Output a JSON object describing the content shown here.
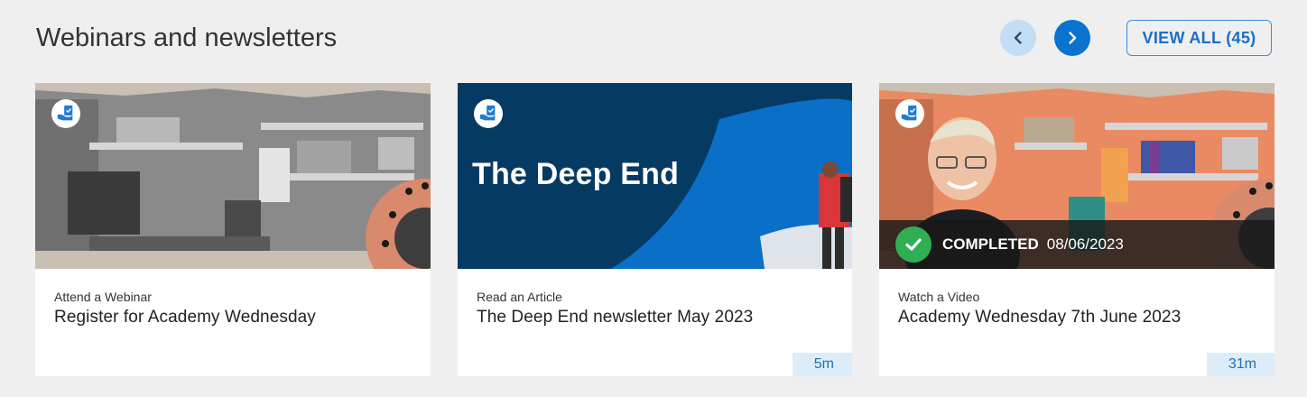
{
  "section": {
    "title": "Webinars and newsletters",
    "view_all_label": "VIEW ALL (45)"
  },
  "colors": {
    "accent": "#0a72cf",
    "completed_green": "#2fae52",
    "newsletter_navy": "#053a63"
  },
  "cards": [
    {
      "icon": "hand-with-document-icon",
      "kind": "Attend a Webinar",
      "title": "Register for Academy Wednesday",
      "duration": ""
    },
    {
      "icon": "hand-with-document-icon",
      "kind": "Read an Article",
      "title": "The Deep End newsletter May 2023",
      "thumb_text": "The Deep End",
      "duration": "5m"
    },
    {
      "icon": "hand-with-document-icon",
      "kind": "Watch a Video",
      "title": "Academy Wednesday 7th June 2023",
      "status_label": "COMPLETED",
      "status_date": "08/06/2023",
      "duration": "31m"
    }
  ]
}
